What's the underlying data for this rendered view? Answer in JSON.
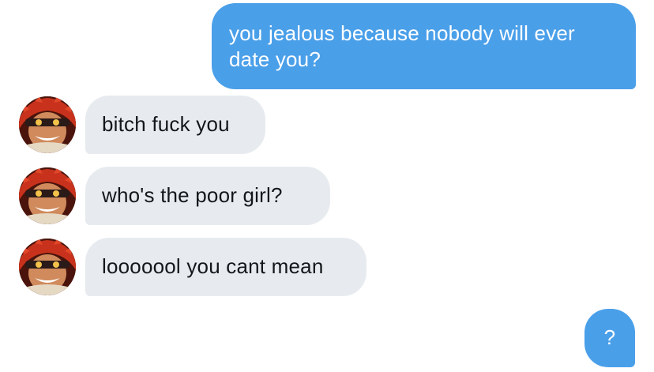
{
  "conversation": {
    "messages": [
      {
        "direction": "sent",
        "text": "you jealous because nobody will ever date you?"
      },
      {
        "direction": "received",
        "text": "bitch fuck you"
      },
      {
        "direction": "received",
        "text": "who's the poor girl?"
      },
      {
        "direction": "received",
        "text": "looooool you cant mean"
      },
      {
        "direction": "sent",
        "text": "?"
      }
    ]
  },
  "theme": {
    "sent_bubble_color": "#4a9fe9",
    "received_bubble_color": "#e7ebef",
    "sent_text_color": "#ffffff",
    "received_text_color": "#14171a"
  },
  "icons": {
    "avatar": "avatar-icon"
  }
}
